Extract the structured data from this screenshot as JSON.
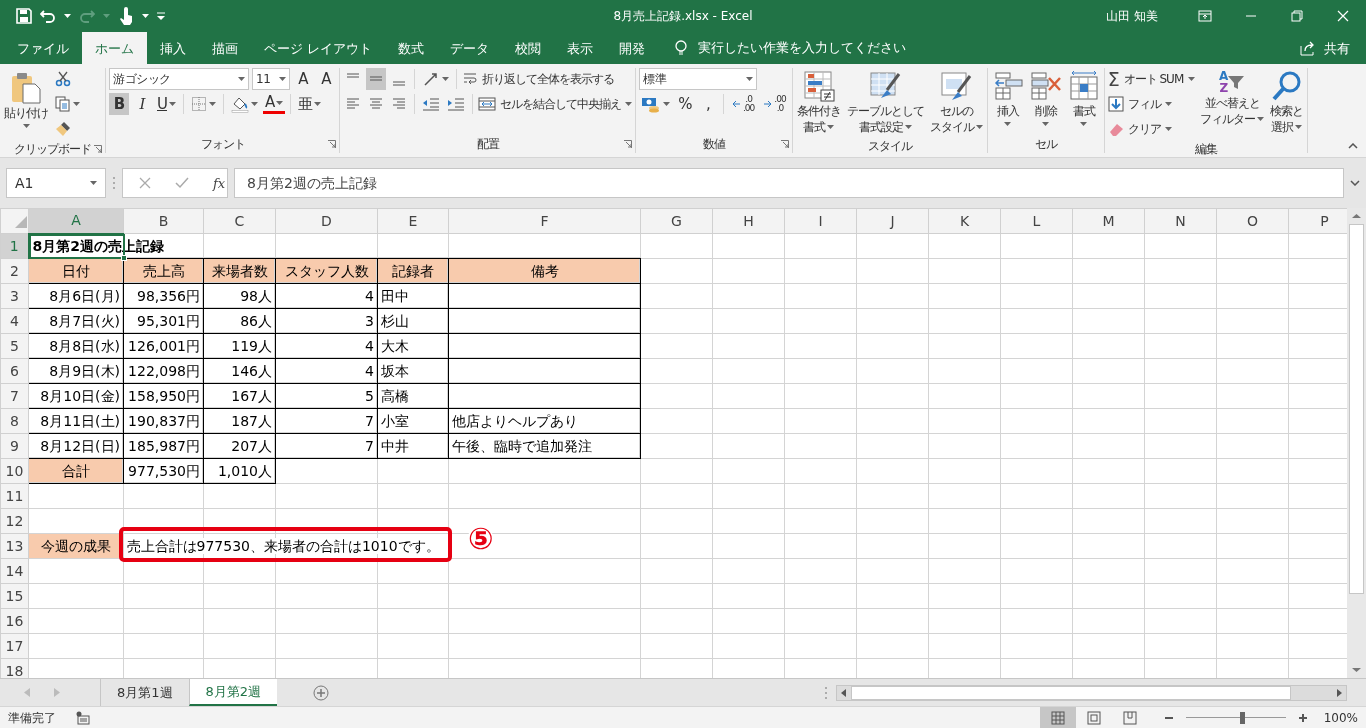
{
  "window": {
    "title": "8月売上記録.xlsx - Excel",
    "user": "山田 知美"
  },
  "quick_access": [
    {
      "kind": "save"
    },
    {
      "kind": "undo",
      "disabled": false
    },
    {
      "kind": "redo",
      "disabled": true
    },
    {
      "kind": "touch"
    },
    {
      "kind": "customize"
    }
  ],
  "tabs": [
    {
      "label": "ファイル",
      "selected": false
    },
    {
      "label": "ホーム",
      "selected": true
    },
    {
      "label": "挿入",
      "selected": false
    },
    {
      "label": "描画",
      "selected": false
    },
    {
      "label": "ページ レイアウト",
      "selected": false
    },
    {
      "label": "数式",
      "selected": false
    },
    {
      "label": "データ",
      "selected": false
    },
    {
      "label": "校閲",
      "selected": false
    },
    {
      "label": "表示",
      "selected": false
    },
    {
      "label": "開発",
      "selected": false
    }
  ],
  "tell_me": {
    "placeholder": "実行したい作業を入力してください"
  },
  "share": "共有",
  "ribbon": [
    {
      "label": "クリップボード",
      "launcher": true,
      "blocks": [
        {
          "kind": "large",
          "lines": [
            "貼り付け"
          ],
          "menu": true
        },
        {
          "kind": "stack",
          "rows": [
            {
              "items": [
                {
                  "kind": "icon"
                }
              ]
            },
            {
              "items": [
                {
                  "kind": "icon",
                  "menu": true
                }
              ]
            },
            {
              "items": [
                {
                  "kind": "icon"
                }
              ]
            }
          ]
        }
      ]
    },
    {
      "label": "フォント",
      "launcher": true,
      "blocks": [
        {
          "kind": "stack",
          "rows": [
            {
              "items": [
                {
                  "kind": "font-combo",
                  "value": "游ゴシック"
                },
                {
                  "kind": "size-combo",
                  "value": "11"
                },
                {
                  "kind": "grow",
                  "label": "A"
                },
                {
                  "kind": "shrink",
                  "label": "A"
                }
              ]
            },
            {
              "items": [
                {
                  "kind": "bold",
                  "label": "B",
                  "pressed": true
                },
                {
                  "kind": "italic",
                  "label": "I",
                  "pressed": false
                },
                {
                  "kind": "underline",
                  "label": "U",
                  "pressed": false,
                  "menu": true
                },
                {
                  "kind": "sep"
                },
                {
                  "kind": "icon",
                  "menu": true
                },
                {
                  "kind": "sep"
                },
                {
                  "kind": "icon",
                  "menu": true
                },
                {
                  "kind": "font-color",
                  "label": "A",
                  "menu": true
                },
                {
                  "kind": "sep"
                },
                {
                  "kind": "phonetic",
                  "label": "亜",
                  "menu": true
                }
              ]
            }
          ]
        }
      ]
    },
    {
      "label": "配置",
      "launcher": true,
      "blocks": [
        {
          "kind": "stack",
          "rows": [
            {
              "items": [
                {
                  "kind": "icon",
                  "pressed": false
                },
                {
                  "kind": "icon",
                  "pressed": true
                },
                {
                  "kind": "icon",
                  "pressed": false
                },
                {
                  "kind": "sep"
                },
                {
                  "kind": "icon",
                  "menu": true
                },
                {
                  "kind": "sep"
                },
                {
                  "kind": "text",
                  "label": "折り返して全体を表示する"
                }
              ]
            },
            {
              "items": [
                {
                  "kind": "icon"
                },
                {
                  "kind": "icon"
                },
                {
                  "kind": "icon"
                },
                {
                  "kind": "sep"
                },
                {
                  "kind": "icon"
                },
                {
                  "kind": "icon"
                },
                {
                  "kind": "sep"
                },
                {
                  "kind": "text",
                  "label": "セルを結合して中央揃え",
                  "menu": true
                }
              ]
            }
          ]
        }
      ]
    },
    {
      "label": "数値",
      "launcher": true,
      "blocks": [
        {
          "kind": "stack",
          "rows": [
            {
              "items": [
                {
                  "kind": "format-combo",
                  "value": "標準"
                }
              ]
            },
            {
              "items": [
                {
                  "kind": "icon",
                  "menu": true
                },
                {
                  "kind": "glyph",
                  "label": "%"
                },
                {
                  "kind": "glyph",
                  "label": ","
                },
                {
                  "kind": "sep"
                },
                {
                  "kind": "decimal",
                  "lines": [
                    ".0",
                    ".00"
                  ]
                },
                {
                  "kind": "decimal",
                  "lines": [
                    ".00",
                    ".0"
                  ]
                }
              ]
            }
          ]
        }
      ]
    },
    {
      "label": "スタイル",
      "launcher": false,
      "blocks": [
        {
          "kind": "large",
          "lines": [
            "条件付き",
            "書式"
          ],
          "menu": true
        },
        {
          "kind": "large",
          "lines": [
            "テーブルとして",
            "書式設定"
          ],
          "menu": true
        },
        {
          "kind": "large",
          "lines": [
            "セルの",
            "スタイル"
          ],
          "menu": true
        }
      ]
    },
    {
      "label": "セル",
      "launcher": false,
      "blocks": [
        {
          "kind": "large",
          "lines": [
            "挿入"
          ],
          "menu": true
        },
        {
          "kind": "large",
          "lines": [
            "削除"
          ],
          "menu": true
        },
        {
          "kind": "large",
          "lines": [
            "書式"
          ],
          "menu": true
        }
      ]
    },
    {
      "label": "編集",
      "launcher": false,
      "blocks": [
        {
          "kind": "stack",
          "rows": [
            {
              "items": [
                {
                  "kind": "symbol-text",
                  "symbol": "Σ",
                  "label": "オート SUM",
                  "menu": true
                }
              ]
            },
            {
              "items": [
                {
                  "kind": "text",
                  "label": "フィル",
                  "menu": true
                }
              ]
            },
            {
              "items": [
                {
                  "kind": "text",
                  "label": "クリア",
                  "menu": true
                }
              ]
            }
          ]
        },
        {
          "kind": "large",
          "lines": [
            "並べ替えと",
            "フィルター"
          ],
          "glyphs": [
            "A",
            "Z"
          ],
          "menu": true
        },
        {
          "kind": "large",
          "lines": [
            "検索と",
            "選択"
          ],
          "menu": true
        }
      ]
    }
  ],
  "formula_bar": {
    "name_box": "A1",
    "function_label": "fx",
    "formula": "8月第2週の売上記録"
  },
  "sheet": {
    "columns": [
      {
        "label": "A",
        "selected": true
      },
      {
        "label": "B",
        "selected": false
      },
      {
        "label": "C",
        "selected": false
      },
      {
        "label": "D",
        "selected": false
      },
      {
        "label": "E",
        "selected": false
      },
      {
        "label": "F",
        "selected": false
      },
      {
        "label": "G",
        "selected": false
      },
      {
        "label": "H",
        "selected": false
      },
      {
        "label": "I",
        "selected": false
      },
      {
        "label": "J",
        "selected": false
      },
      {
        "label": "K",
        "selected": false
      },
      {
        "label": "L",
        "selected": false
      },
      {
        "label": "M",
        "selected": false
      },
      {
        "label": "N",
        "selected": false
      },
      {
        "label": "O",
        "selected": false
      },
      {
        "label": "P",
        "selected": false
      }
    ],
    "rows": [
      {
        "number": "1",
        "selected": true,
        "cells": [
          {
            "kind": "text",
            "text": "8月第2週の売上記録",
            "bold": true
          }
        ]
      },
      {
        "number": "2",
        "selected": false,
        "cells": [
          {
            "kind": "heading",
            "text": "日付",
            "fill": true,
            "bordered": true
          },
          {
            "kind": "heading",
            "text": "売上高",
            "fill": true,
            "bordered": true
          },
          {
            "kind": "heading",
            "text": "来場者数",
            "fill": true,
            "bordered": true
          },
          {
            "kind": "heading",
            "text": "スタッフ人数",
            "fill": true,
            "bordered": true
          },
          {
            "kind": "heading",
            "text": "記録者",
            "fill": true,
            "bordered": true
          },
          {
            "kind": "heading",
            "text": "備考",
            "fill": true,
            "bordered": true
          }
        ]
      },
      {
        "number": "3",
        "selected": false,
        "cells": [
          {
            "kind": "number",
            "text": "8月6日(月)",
            "bordered": true
          },
          {
            "kind": "number",
            "text": "98,356円",
            "bordered": true
          },
          {
            "kind": "number",
            "text": "98人",
            "bordered": true
          },
          {
            "kind": "number",
            "text": "4",
            "bordered": true
          },
          {
            "kind": "text",
            "text": "田中",
            "bordered": true
          },
          {
            "kind": "text",
            "bordered": true
          }
        ]
      },
      {
        "number": "4",
        "selected": false,
        "cells": [
          {
            "kind": "number",
            "text": "8月7日(火)",
            "bordered": true
          },
          {
            "kind": "number",
            "text": "95,301円",
            "bordered": true
          },
          {
            "kind": "number",
            "text": "86人",
            "bordered": true
          },
          {
            "kind": "number",
            "text": "3",
            "bordered": true
          },
          {
            "kind": "text",
            "text": "杉山",
            "bordered": true
          },
          {
            "kind": "text",
            "bordered": true
          }
        ]
      },
      {
        "number": "5",
        "selected": false,
        "cells": [
          {
            "kind": "number",
            "text": "8月8日(水)",
            "bordered": true
          },
          {
            "kind": "number",
            "text": "126,001円",
            "bordered": true
          },
          {
            "kind": "number",
            "text": "119人",
            "bordered": true
          },
          {
            "kind": "number",
            "text": "4",
            "bordered": true
          },
          {
            "kind": "text",
            "text": "大木",
            "bordered": true
          },
          {
            "kind": "text",
            "bordered": true
          }
        ]
      },
      {
        "number": "6",
        "selected": false,
        "cells": [
          {
            "kind": "number",
            "text": "8月9日(木)",
            "bordered": true
          },
          {
            "kind": "number",
            "text": "122,098円",
            "bordered": true
          },
          {
            "kind": "number",
            "text": "146人",
            "bordered": true
          },
          {
            "kind": "number",
            "text": "4",
            "bordered": true
          },
          {
            "kind": "text",
            "text": "坂本",
            "bordered": true
          },
          {
            "kind": "text",
            "bordered": true
          }
        ]
      },
      {
        "number": "7",
        "selected": false,
        "cells": [
          {
            "kind": "number",
            "text": "8月10日(金)",
            "bordered": true
          },
          {
            "kind": "number",
            "text": "158,950円",
            "bordered": true
          },
          {
            "kind": "number",
            "text": "167人",
            "bordered": true
          },
          {
            "kind": "number",
            "text": "5",
            "bordered": true
          },
          {
            "kind": "text",
            "text": "高橋",
            "bordered": true
          },
          {
            "kind": "text",
            "bordered": true
          }
        ]
      },
      {
        "number": "8",
        "selected": false,
        "cells": [
          {
            "kind": "number",
            "text": "8月11日(土)",
            "bordered": true
          },
          {
            "kind": "number",
            "text": "190,837円",
            "bordered": true
          },
          {
            "kind": "number",
            "text": "187人",
            "bordered": true
          },
          {
            "kind": "number",
            "text": "7",
            "bordered": true
          },
          {
            "kind": "text",
            "text": "小室",
            "bordered": true
          },
          {
            "kind": "text",
            "text": "他店よりヘルプあり",
            "bordered": true
          }
        ]
      },
      {
        "number": "9",
        "selected": false,
        "cells": [
          {
            "kind": "number",
            "text": "8月12日(日)",
            "bordered": true
          },
          {
            "kind": "number",
            "text": "185,987円",
            "bordered": true
          },
          {
            "kind": "number",
            "text": "207人",
            "bordered": true
          },
          {
            "kind": "number",
            "text": "7",
            "bordered": true
          },
          {
            "kind": "text",
            "text": "中井",
            "bordered": true
          },
          {
            "kind": "text",
            "text": "午後、臨時で追加発注",
            "bordered": true
          }
        ]
      },
      {
        "number": "10",
        "selected": false,
        "cells": [
          {
            "kind": "heading",
            "text": "合計",
            "fill": true,
            "bordered": true
          },
          {
            "kind": "number",
            "text": "977,530円",
            "bordered": true
          },
          {
            "kind": "number",
            "text": "1,010人",
            "bordered": true
          }
        ]
      },
      {
        "number": "11",
        "selected": false
      },
      {
        "number": "12",
        "selected": false
      },
      {
        "number": "13",
        "selected": false,
        "cells": [
          {
            "kind": "heading",
            "text": "今週の成果",
            "fill": true
          },
          {
            "kind": "text",
            "text": "売上合計は977530、来場者の合計は1010です。"
          }
        ]
      },
      {
        "number": "14",
        "selected": false
      },
      {
        "number": "15",
        "selected": false
      },
      {
        "number": "16",
        "selected": false
      },
      {
        "number": "17",
        "selected": false
      },
      {
        "number": "18",
        "selected": false
      }
    ]
  },
  "annotation": {
    "step": "⑤"
  },
  "sheet_tabs": [
    {
      "label": "8月第1週",
      "selected": false
    },
    {
      "label": "8月第2週",
      "selected": true
    }
  ],
  "status_bar": {
    "text": "準備完了",
    "views": [
      {
        "selected": true
      },
      {
        "selected": false
      },
      {
        "selected": false
      }
    ],
    "zoom": {
      "level": 0.57,
      "label": "100%"
    }
  }
}
